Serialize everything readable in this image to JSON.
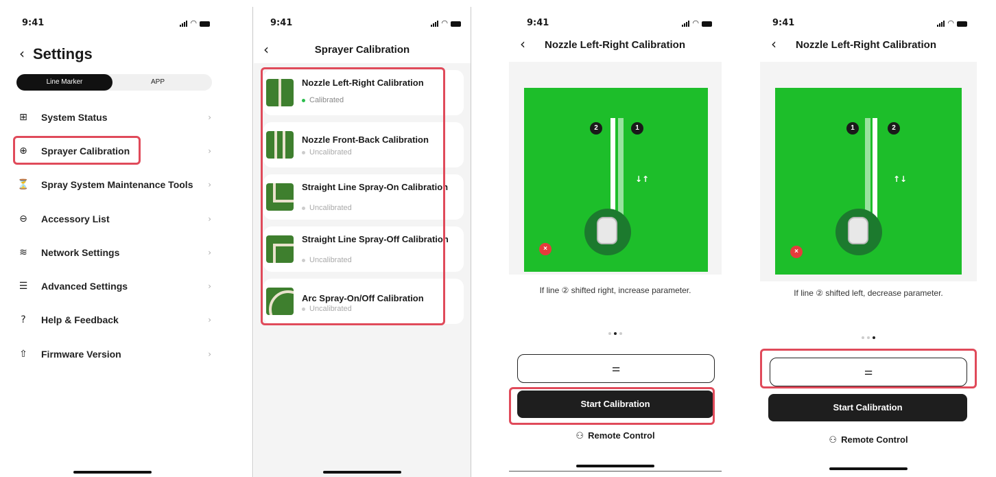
{
  "status": {
    "time": "9:41"
  },
  "screen1": {
    "back_icon": "chevron-left-icon",
    "title": "Settings",
    "segments": [
      {
        "label": "Line Marker",
        "active": true
      },
      {
        "label": "APP",
        "active": false
      }
    ],
    "menu": [
      {
        "icon": "grid-icon",
        "glyph": "⊞",
        "label": "System Status"
      },
      {
        "icon": "target-icon",
        "glyph": "⊕",
        "label": "Sprayer Calibration",
        "highlighted": true
      },
      {
        "icon": "nozzle-icon",
        "glyph": "⏳",
        "label": "Spray System Maintenance Tools"
      },
      {
        "icon": "accessory-icon",
        "glyph": "⊖",
        "label": "Accessory List"
      },
      {
        "icon": "wifi-icon",
        "glyph": "≋",
        "label": "Network Settings"
      },
      {
        "icon": "sliders-icon",
        "glyph": "☰",
        "label": "Advanced Settings"
      },
      {
        "icon": "help-icon",
        "glyph": "?",
        "label": "Help & Feedback"
      },
      {
        "icon": "upload-icon",
        "glyph": "⇧",
        "label": "Firmware Version"
      }
    ]
  },
  "screen2": {
    "title": "Sprayer Calibration",
    "items": [
      {
        "title": "Nozzle Left-Right Calibration",
        "status": "Calibrated",
        "calibrated": true
      },
      {
        "title": "Nozzle Front-Back Calibration",
        "status": "Uncalibrated",
        "calibrated": false
      },
      {
        "title": "Straight Line Spray-On Calibration",
        "status": "Uncalibrated",
        "calibrated": false
      },
      {
        "title": "Straight Line Spray-Off Calibration",
        "status": "Uncalibrated",
        "calibrated": false
      },
      {
        "title": "Arc Spray-On/Off Calibration",
        "status": "Uncalibrated",
        "calibrated": false
      }
    ]
  },
  "screen3": {
    "title": "Nozzle Left-Right Calibration",
    "badge_left": "2",
    "badge_right": "1",
    "arrows": "↓↑",
    "instruction": "If line ② shifted right, increase parameter.",
    "page_index": 2,
    "param_icon": "sliders-icon",
    "start_label": "Start Calibration",
    "remote_label": "Remote Control"
  },
  "screen4": {
    "title": "Nozzle Left-Right Calibration",
    "badge_left": "1",
    "badge_right": "2",
    "arrows": "↑↓",
    "instruction": "If line ② shifted left, decrease parameter.",
    "page_index": 3,
    "param_icon": "sliders-icon",
    "start_label": "Start Calibration",
    "remote_label": "Remote Control"
  },
  "colors": {
    "highlight": "#e04a5a",
    "field_green": "#1dbe2a",
    "ok_green": "#2bbd4d",
    "button_dark": "#1e1e1e"
  }
}
